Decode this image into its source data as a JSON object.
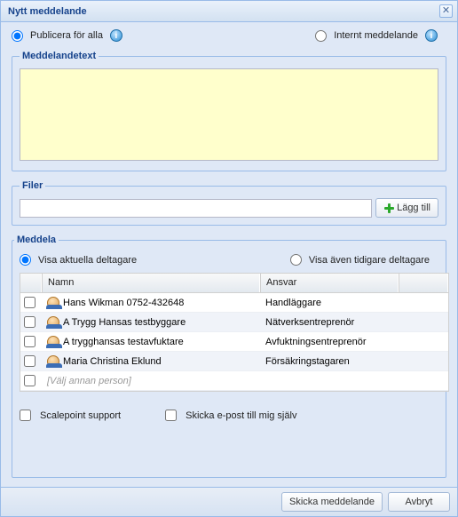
{
  "title": "Nytt meddelande",
  "publish": {
    "publish_all": "Publicera för alla",
    "internal": "Internt meddelande"
  },
  "message": {
    "legend": "Meddelandetext",
    "value": ""
  },
  "files": {
    "legend": "Filer",
    "value": "",
    "add_label": "Lägg till"
  },
  "notify": {
    "legend": "Meddela",
    "show_current": "Visa aktuella deltagare",
    "show_previous": "Visa även tidigare deltagare",
    "columns": {
      "name": "Namn",
      "role": "Ansvar"
    },
    "rows": [
      {
        "name": "Hans Wikman 0752-432648",
        "role": "Handläggare"
      },
      {
        "name": "A Trygg Hansas testbyggare",
        "role": "Nätverksentreprenör"
      },
      {
        "name": "A trygghansas testavfuktare",
        "role": "Avfuktningsentreprenör"
      },
      {
        "name": "Maria Christina Eklund",
        "role": "Försäkringstagaren"
      }
    ],
    "placeholder_row": "[Välj annan person]"
  },
  "options": {
    "scalepoint": "Scalepoint support",
    "email_self": "Skicka e-post till mig själv"
  },
  "footer": {
    "send": "Skicka meddelande",
    "cancel": "Avbryt"
  }
}
